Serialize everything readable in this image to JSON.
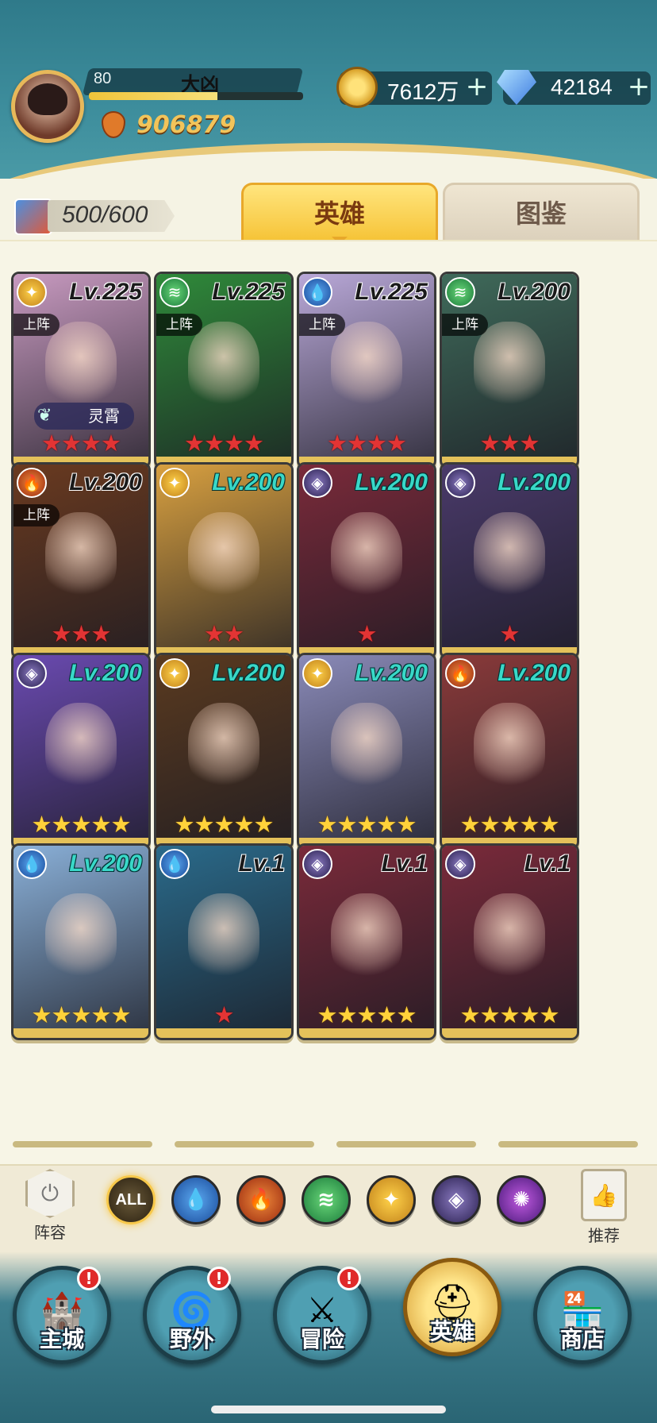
{
  "player": {
    "level": "80",
    "name": "大凶",
    "exp_fraction": 0.6,
    "power": "906879"
  },
  "resources": {
    "gold": "7612万",
    "diamonds": "42184",
    "plus_symbol": "+"
  },
  "tabs": [
    {
      "label": "英雄",
      "active": true
    },
    {
      "label": "图鉴",
      "active": false
    }
  ],
  "card_count": "500/600",
  "heroes": [
    {
      "level": "Lv.225",
      "element": "light",
      "deployed": true,
      "tag": "灵霄",
      "stars": "★★★★",
      "star_color": "red",
      "art": "#c89ac0"
    },
    {
      "level": "Lv.225",
      "element": "wind",
      "deployed": true,
      "stars": "★★★★",
      "star_color": "red",
      "art": "#2f8a3a"
    },
    {
      "level": "Lv.225",
      "element": "water",
      "deployed": true,
      "stars": "★★★★",
      "star_color": "red",
      "art": "#b9a8d8"
    },
    {
      "level": "Lv.200",
      "element": "wind",
      "deployed": true,
      "stars": "★★★",
      "star_color": "red",
      "art": "#3f6a5a"
    },
    {
      "level": "Lv.200",
      "element": "fire",
      "deployed": true,
      "stars": "★★★",
      "star_color": "red",
      "art": "#6a3a20"
    },
    {
      "level": "Lv.200",
      "element": "light",
      "deployed": false,
      "stars": "★★",
      "star_color": "red",
      "art": "#d8a040"
    },
    {
      "level": "Lv.200",
      "element": "dark",
      "deployed": false,
      "stars": "★",
      "star_color": "red",
      "art": "#7a2a3a"
    },
    {
      "level": "Lv.200",
      "element": "dark",
      "deployed": false,
      "stars": "★",
      "star_color": "red",
      "art": "#4a3a6a"
    },
    {
      "level": "Lv.200",
      "element": "dark",
      "deployed": false,
      "stars": "★★★★★",
      "star_color": "gold",
      "art": "#6a4ab0"
    },
    {
      "level": "Lv.200",
      "element": "light",
      "deployed": false,
      "stars": "★★★★★",
      "star_color": "gold",
      "art": "#5a3a20"
    },
    {
      "level": "Lv.200",
      "element": "light",
      "deployed": false,
      "stars": "★★★★★",
      "star_color": "gold",
      "art": "#8a8ab8"
    },
    {
      "level": "Lv.200",
      "element": "fire",
      "deployed": false,
      "stars": "★★★★★",
      "star_color": "gold",
      "art": "#8a3a3a"
    },
    {
      "level": "Lv.200",
      "element": "water",
      "deployed": false,
      "stars": "★★★★★",
      "star_color": "gold",
      "art": "#8ab0d8"
    },
    {
      "level": "Lv.1",
      "element": "water",
      "deployed": false,
      "stars": "★",
      "star_color": "red",
      "art": "#2a6a8a"
    },
    {
      "level": "Lv.1",
      "element": "dark",
      "deployed": false,
      "stars": "★★★★★",
      "star_color": "gold",
      "art": "#7a2a3a"
    },
    {
      "level": "Lv.1",
      "element": "dark",
      "deployed": false,
      "stars": "★★★★★",
      "star_color": "gold",
      "art": "#7a2a3a"
    }
  ],
  "deployed_label": "上阵",
  "filters": {
    "all_label": "ALL",
    "lineup_label": "阵容",
    "recommend_label": "推荐"
  },
  "nav": [
    {
      "label": "主城",
      "icon": "castle-icon",
      "badge": "!"
    },
    {
      "label": "野外",
      "icon": "portal-icon",
      "badge": "!"
    },
    {
      "label": "冒险",
      "icon": "sword-icon",
      "badge": "!"
    },
    {
      "label": "英雄",
      "icon": "helmet-icon",
      "badge": ""
    },
    {
      "label": "商店",
      "icon": "shop-icon",
      "badge": ""
    }
  ],
  "colors": {
    "accent_gold": "#f6c438",
    "header_teal": "#2f7a8a",
    "star_red": "#e33434",
    "star_gold": "#ffd23a"
  }
}
